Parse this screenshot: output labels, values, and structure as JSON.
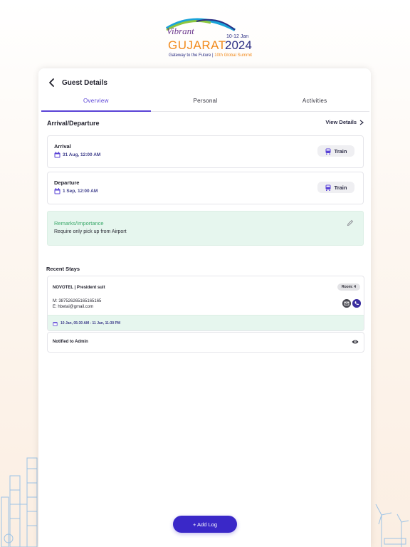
{
  "logo": {
    "vibrant": "Vibrant",
    "gujarat": "GUJARAT",
    "dates": "10-12 Jan",
    "year": "2024",
    "tagline_a": "Gateway to the Future |",
    "tagline_b": "10th Global Summit"
  },
  "header": {
    "title": "Guest Details"
  },
  "tabs": [
    {
      "label": "Overview",
      "active": true
    },
    {
      "label": "Personal",
      "active": false
    },
    {
      "label": "Activities",
      "active": false
    }
  ],
  "arrival_departure": {
    "title": "Arrival/Departure",
    "view_details": "View Details",
    "arrival": {
      "label": "Arrival",
      "datetime": "31 Aug, 12:00 AM",
      "mode": "Train"
    },
    "departure": {
      "label": "Departure",
      "datetime": "1 Sep, 12:00 AM",
      "mode": "Train"
    }
  },
  "remarks": {
    "title": "Remarks/Importance",
    "text": "Require only pick up from Airport"
  },
  "recent_stays": {
    "title": "Recent Stays",
    "hotel": "NOVOTEL | President suit",
    "room": "Room: 4",
    "mobile": "M: 387526265165165165",
    "email": "E: hbetai@gmail.com",
    "dates": "10 Jan, 05:30 AM - 11 Jan, 11:30 PM"
  },
  "notified": {
    "text": "Notified to Admin"
  },
  "add_log": {
    "label": "+ Add Log"
  },
  "colors": {
    "accent": "#3a28c8",
    "tab_active": "#5a43d6",
    "remarks_bg": "#e6f6ee",
    "remarks_title": "#3aa86a"
  }
}
